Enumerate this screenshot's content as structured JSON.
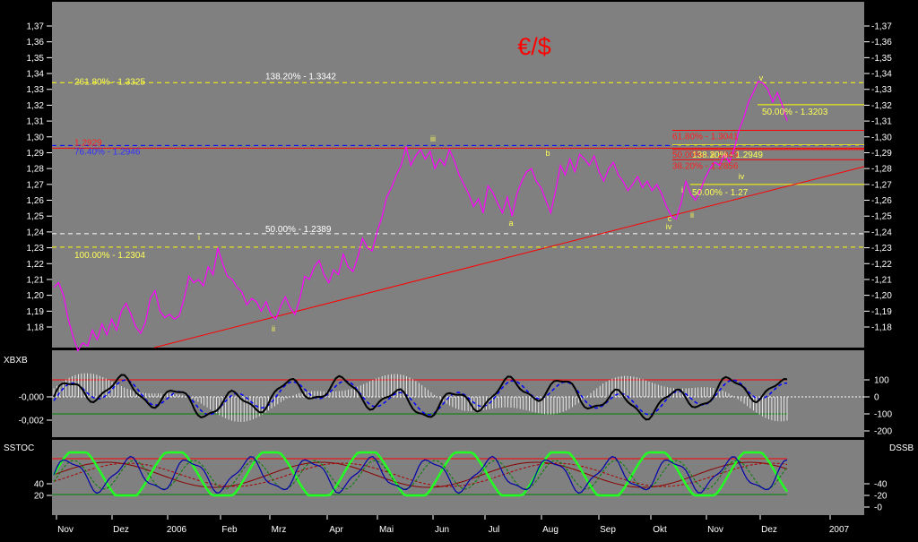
{
  "chart_data": [
    {
      "type": "line",
      "title": "€/$",
      "ylim": [
        1.16,
        1.375
      ],
      "yticks": [
        "1,37",
        "1,36",
        "1,35",
        "1,34",
        "1,33",
        "1,32",
        "1,31",
        "1,30",
        "1,29",
        "1,28",
        "1,27",
        "1,26",
        "1,25",
        "1,24",
        "1,23",
        "1,22",
        "1,21",
        "1,20",
        "1,19",
        "1,18"
      ],
      "x_labels": [
        "Nov",
        "Dez",
        "2006",
        "Feb",
        "Mrz",
        "Apr",
        "Mai",
        "Jun",
        "Jul",
        "Aug",
        "Sep",
        "Okt",
        "Nov",
        "Dez",
        "2007"
      ],
      "series": [
        {
          "values": [
            1.205,
            1.208,
            1.2,
            1.185,
            1.174,
            1.165,
            1.17,
            1.168,
            1.178,
            1.172,
            1.182,
            1.175,
            1.185,
            1.178,
            1.19,
            1.195,
            1.188,
            1.18,
            1.176,
            1.183,
            1.198,
            1.203,
            1.19,
            1.186,
            1.188,
            1.185,
            1.187,
            1.198,
            1.212,
            1.208,
            1.21,
            1.206,
            1.218,
            1.213,
            1.23,
            1.22,
            1.212,
            1.21,
            1.205,
            1.202,
            1.194,
            1.198,
            1.196,
            1.19,
            1.196,
            1.188,
            1.185,
            1.193,
            1.199,
            1.192,
            1.188,
            1.198,
            1.212,
            1.21,
            1.218,
            1.222,
            1.213,
            1.208,
            1.216,
            1.213,
            1.226,
            1.218,
            1.215,
            1.224,
            1.236,
            1.23,
            1.228,
            1.24,
            1.249,
            1.262,
            1.268,
            1.276,
            1.282,
            1.294,
            1.282,
            1.288,
            1.292,
            1.286,
            1.291,
            1.28,
            1.286,
            1.282,
            1.292,
            1.285,
            1.276,
            1.27,
            1.264,
            1.256,
            1.261,
            1.252,
            1.269,
            1.265,
            1.258,
            1.252,
            1.262,
            1.25,
            1.264,
            1.272,
            1.278,
            1.28,
            1.272,
            1.268,
            1.26,
            1.252,
            1.266,
            1.282,
            1.276,
            1.286,
            1.278,
            1.289,
            1.286,
            1.282,
            1.288,
            1.278,
            1.272,
            1.28,
            1.284,
            1.276,
            1.272,
            1.266,
            1.27,
            1.275,
            1.268,
            1.272,
            1.266,
            1.27,
            1.264,
            1.256,
            1.25,
            1.248,
            1.258,
            1.272,
            1.264,
            1.26,
            1.266,
            1.274,
            1.28,
            1.284,
            1.282,
            1.289,
            1.284,
            1.292,
            1.304,
            1.312,
            1.322,
            1.328,
            1.335,
            1.334,
            1.33,
            1.322,
            1.328,
            1.32,
            1.31
          ]
        }
      ],
      "annotations": [
        {
          "text": "261.80% - 1.3325",
          "y": 1.3325,
          "color": "#ffff55"
        },
        {
          "text": "138.20% - 1.3342",
          "y": 1.3342,
          "color": "#ffffff"
        },
        {
          "text": "1.2929",
          "y": 1.2929,
          "color": "#ff2020"
        },
        {
          "text": "76.40% - 1.2946",
          "y": 1.2946,
          "color": "#3030ff"
        },
        {
          "text": "50.00% - 1.2389",
          "y": 1.2389,
          "color": "#ffffff"
        },
        {
          "text": "100.00% - 1.2304",
          "y": 1.2304,
          "color": "#ffff55"
        },
        {
          "text": "50.00% - 1.3203",
          "y": 1.3203,
          "color": "#ffff55"
        },
        {
          "text": "61.80% - 1.3041",
          "y": 1.3041,
          "color": "#ff2020"
        },
        {
          "text": "50.00% - 1.2949",
          "y": 1.2949,
          "color": "#ff2020"
        },
        {
          "text": "138.20% - 1.2949",
          "y": 1.2949,
          "color": "#ffff55"
        },
        {
          "text": "38.20% - 1.2856",
          "y": 1.2856,
          "color": "#ff2020"
        },
        {
          "text": "50.00% - 1.27",
          "y": 1.27,
          "color": "#ffff55"
        }
      ],
      "wave_labels": [
        "i",
        "ii",
        "iii",
        "a",
        "b",
        "c",
        "iv",
        "i",
        "ii",
        "iii",
        "iv",
        "v"
      ]
    },
    {
      "type": "area",
      "title": "XBXB",
      "left_ticks": [
        "-0,000",
        "-0,002"
      ],
      "right_ticks": [
        "100",
        "0",
        "-100",
        "-200"
      ]
    },
    {
      "type": "line",
      "title": "SSTOC",
      "right_title": "DSSB",
      "left_ticks": [
        "40",
        "20"
      ],
      "right_ticks": [
        "40",
        "20",
        "0"
      ]
    }
  ],
  "colors": {
    "background": "#808080",
    "frame": "#000000",
    "price": "#ff00ff",
    "trendline": "#ff0000",
    "title": "#ff0000",
    "fib_yellow": "#ffff00",
    "fib_red": "#ff0000",
    "fib_blue": "#0000ff",
    "fib_white": "#ffffff"
  }
}
